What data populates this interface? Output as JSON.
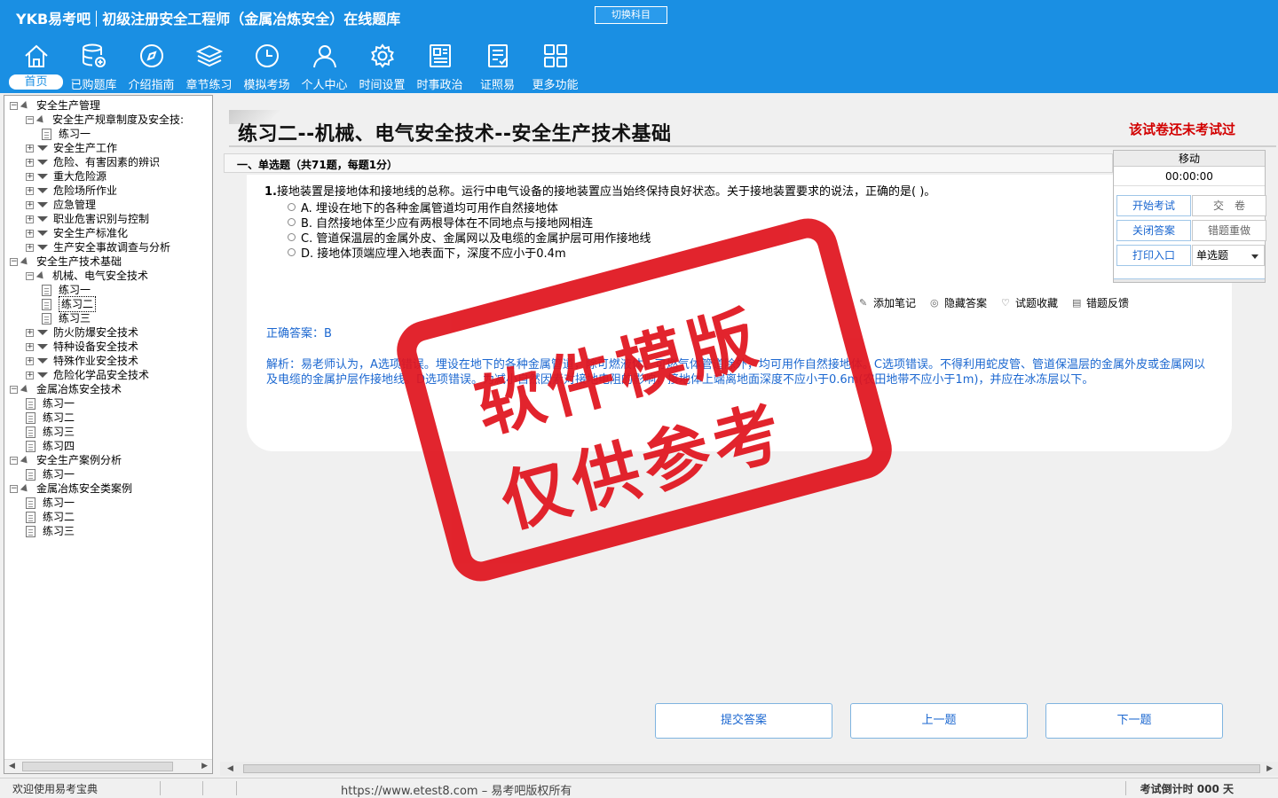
{
  "header": {
    "brand": "YKB易考吧",
    "app_title": "初级注册安全工程师（金属冶炼安全）在线题库",
    "switch_label": "切换科目"
  },
  "nav": [
    {
      "label": "首页",
      "icon": "home-icon"
    },
    {
      "label": "已购题库",
      "icon": "database-icon"
    },
    {
      "label": "介绍指南",
      "icon": "compass-icon"
    },
    {
      "label": "章节练习",
      "icon": "layers-icon"
    },
    {
      "label": "模拟考场",
      "icon": "clock-icon"
    },
    {
      "label": "个人中心",
      "icon": "user-icon"
    },
    {
      "label": "时间设置",
      "icon": "gear-icon"
    },
    {
      "label": "时事政治",
      "icon": "news-icon"
    },
    {
      "label": "证照易",
      "icon": "certificate-icon"
    },
    {
      "label": "更多功能",
      "icon": "grid-icon"
    }
  ],
  "tree": [
    {
      "label": "安全生产管理",
      "level": 0,
      "type": "open"
    },
    {
      "label": "安全生产规章制度及安全技:",
      "level": 1,
      "type": "open"
    },
    {
      "label": "练习一",
      "level": 2,
      "type": "doc"
    },
    {
      "label": "安全生产工作",
      "level": 1,
      "type": "closed"
    },
    {
      "label": "危险、有害因素的辨识",
      "level": 1,
      "type": "closed"
    },
    {
      "label": "重大危险源",
      "level": 1,
      "type": "closed"
    },
    {
      "label": "危险场所作业",
      "level": 1,
      "type": "closed"
    },
    {
      "label": "应急管理",
      "level": 1,
      "type": "closed"
    },
    {
      "label": "职业危害识别与控制",
      "level": 1,
      "type": "closed"
    },
    {
      "label": "安全生产标准化",
      "level": 1,
      "type": "closed"
    },
    {
      "label": "生产安全事故调查与分析",
      "level": 1,
      "type": "closed"
    },
    {
      "label": "安全生产技术基础",
      "level": 0,
      "type": "open"
    },
    {
      "label": "机械、电气安全技术",
      "level": 1,
      "type": "open"
    },
    {
      "label": "练习一",
      "level": 2,
      "type": "doc"
    },
    {
      "label": "练习二",
      "level": 2,
      "type": "doc",
      "selected": true
    },
    {
      "label": "练习三",
      "level": 2,
      "type": "doc"
    },
    {
      "label": "防火防爆安全技术",
      "level": 1,
      "type": "closed"
    },
    {
      "label": "特种设备安全技术",
      "level": 1,
      "type": "closed"
    },
    {
      "label": "特殊作业安全技术",
      "level": 1,
      "type": "closed"
    },
    {
      "label": "危险化学品安全技术",
      "level": 1,
      "type": "closed"
    },
    {
      "label": "金属冶炼安全技术",
      "level": 0,
      "type": "open"
    },
    {
      "label": "练习一",
      "level": 1,
      "type": "doc"
    },
    {
      "label": "练习二",
      "level": 1,
      "type": "doc"
    },
    {
      "label": "练习三",
      "level": 1,
      "type": "doc"
    },
    {
      "label": "练习四",
      "level": 1,
      "type": "doc"
    },
    {
      "label": "安全生产案例分析",
      "level": 0,
      "type": "open"
    },
    {
      "label": "练习一",
      "level": 1,
      "type": "doc"
    },
    {
      "label": "金属冶炼安全类案例",
      "level": 0,
      "type": "open"
    },
    {
      "label": "练习一",
      "level": 1,
      "type": "doc"
    },
    {
      "label": "练习二",
      "level": 1,
      "type": "doc"
    },
    {
      "label": "练习三",
      "level": 1,
      "type": "doc"
    }
  ],
  "main": {
    "page_title": "练习二--机械、电气安全技术--安全生产技术基础",
    "status_note": "该试卷还未考试过",
    "section": "一、单选题（共71题，每题1分）",
    "question_number": "1.",
    "question_text": "接地装置是接地体和接地线的总称。运行中电气设备的接地装置应当始终保持良好状态。关于接地装置要求的说法，正确的是(  )。",
    "options": [
      "A. 埋设在地下的各种金属管道均可用作自然接地体",
      "B. 自然接地体至少应有两根导体在不同地点与接地网相连",
      "C. 管道保温层的金属外皮、金属网以及电缆的金属护层可用作接地线",
      "D. 接地体顶端应埋入地表面下，深度不应小于0.4m"
    ],
    "tools": [
      {
        "label": "添加笔记",
        "icon": "pencil-icon"
      },
      {
        "label": "隐藏答案",
        "icon": "eye-off-icon"
      },
      {
        "label": "试题收藏",
        "icon": "heart-icon"
      },
      {
        "label": "错题反馈",
        "icon": "feedback-icon"
      }
    ],
    "answer": "正确答案：B",
    "analysis": "解析：易老师认为，A选项错误。埋设在地下的各种金属管道，除可燃液体、可燃气体管道除外，均可用作自然接地体。C选项错误。不得利用蛇皮管、管道保温层的金属外皮或金属网以及电缆的金属护层作接地线。D选项错误。为减小自然因素对接地电阻的影响，接地体上端离地面深度不应小于0.6m(农田地带不应小于1m)，并应在冰冻层以下。",
    "buttons": {
      "submit": "提交答案",
      "prev": "上一题",
      "next": "下一题"
    }
  },
  "panel": {
    "header": "移动",
    "timer": "00:00:00",
    "start": "开始考试",
    "hand_in": "交　卷",
    "close_answer": "关闭答案",
    "redo_wrong": "错题重做",
    "print": "打印入口",
    "type_select": "单选题"
  },
  "status": {
    "welcome": "欢迎使用易考宝典",
    "copyright": "https://www.etest8.com – 易考吧版权所有",
    "countdown": "考试倒计时 000 天"
  },
  "watermark": {
    "line1": "软件模版",
    "line2": "仅供参考"
  }
}
